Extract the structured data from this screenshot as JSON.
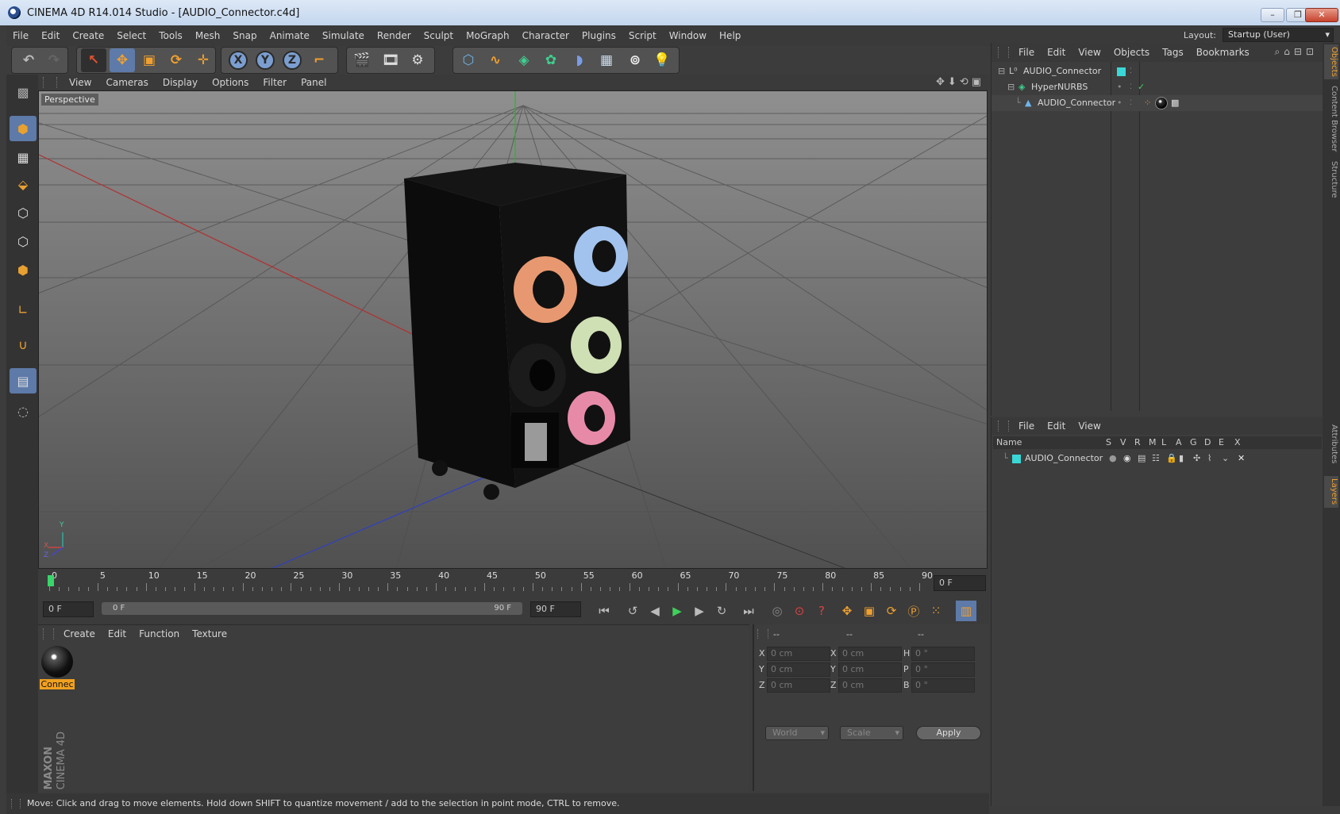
{
  "window": {
    "title": "CINEMA 4D R14.014 Studio - [AUDIO_Connector.c4d]"
  },
  "menubar": {
    "items": [
      "File",
      "Edit",
      "Create",
      "Select",
      "Tools",
      "Mesh",
      "Snap",
      "Animate",
      "Simulate",
      "Render",
      "Sculpt",
      "MoGraph",
      "Character",
      "Plugins",
      "Script",
      "Window",
      "Help"
    ],
    "layout_label": "Layout:",
    "layout_value": "Startup (User)"
  },
  "toolbar": {
    "x_label": "X",
    "y_label": "Y",
    "z_label": "Z"
  },
  "viewport": {
    "menu": [
      "View",
      "Cameras",
      "Display",
      "Options",
      "Filter",
      "Panel"
    ],
    "label": "Perspective",
    "axis_y": "Y",
    "axis_x": "X",
    "axis_z": "Z"
  },
  "timeline": {
    "ticks": [
      "0",
      "5",
      "10",
      "15",
      "20",
      "25",
      "30",
      "35",
      "40",
      "45",
      "50",
      "55",
      "60",
      "65",
      "70",
      "75",
      "80",
      "85",
      "90"
    ],
    "current_frame": "0 F",
    "start_frame": "0 F",
    "range_start": "0 F",
    "range_end": "90 F",
    "end_frame": "90 F"
  },
  "material_manager": {
    "menu": [
      "Create",
      "Edit",
      "Function",
      "Texture"
    ],
    "material_name": "Connec"
  },
  "coordinates": {
    "header": [
      "--",
      "--",
      "--"
    ],
    "rows": [
      {
        "a": "X",
        "av": "0 cm",
        "b": "X",
        "bv": "0 cm",
        "c": "H",
        "cv": "0 °"
      },
      {
        "a": "Y",
        "av": "0 cm",
        "b": "Y",
        "bv": "0 cm",
        "c": "P",
        "cv": "0 °"
      },
      {
        "a": "Z",
        "av": "0 cm",
        "b": "Z",
        "bv": "0 cm",
        "c": "B",
        "cv": "0 °"
      }
    ],
    "world": "World",
    "scale": "Scale",
    "apply": "Apply"
  },
  "object_manager": {
    "menu": [
      "File",
      "Edit",
      "View",
      "Objects",
      "Tags",
      "Bookmarks"
    ],
    "objects": [
      {
        "name": "AUDIO_Connector",
        "level": 0
      },
      {
        "name": "HyperNURBS",
        "level": 1
      },
      {
        "name": "AUDIO_Connector",
        "level": 2
      }
    ]
  },
  "layer_manager": {
    "menu": [
      "File",
      "Edit",
      "View"
    ],
    "columns": [
      "Name",
      "S",
      "V",
      "R",
      "M",
      "L",
      "A",
      "G",
      "D",
      "E",
      "X"
    ],
    "layers": [
      {
        "name": "AUDIO_Connector",
        "color": "#3ad7d7"
      }
    ]
  },
  "right_tabs": [
    "Objects",
    "Content Browser",
    "Structure",
    "Attributes",
    "Layers"
  ],
  "status": "Move: Click and drag to move elements. Hold down SHIFT to quantize movement / add to the selection in point mode, CTRL to remove.",
  "branding": {
    "maxon": "MAXON",
    "product": "CINEMA 4D"
  },
  "colors": {
    "accent": "#f0a030",
    "selection": "#f0a020",
    "layer_cyan": "#3ad7d7"
  }
}
